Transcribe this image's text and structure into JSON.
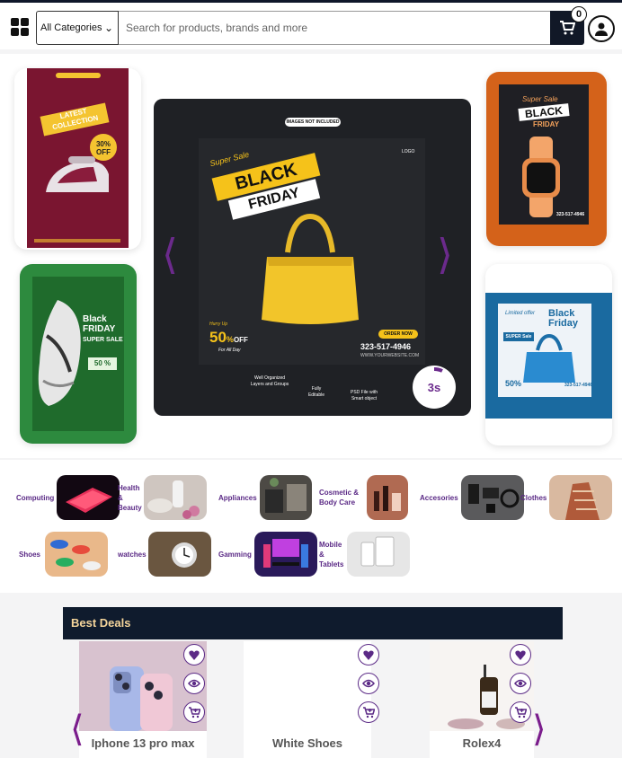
{
  "header": {
    "category_select": "All Categories",
    "search_placeholder": "Search for products, brands and more",
    "cart_count": "0"
  },
  "hero": {
    "timer": "3s",
    "main_banner": {
      "tag": "IMAGES NOT INCLUDED",
      "script": "Super Sale",
      "line1": "BLACK",
      "line2": "FRIDAY",
      "logo": "LOGO",
      "upto": "Hurry Up",
      "discount": "50",
      "discount_unit": "%",
      "off": "OFF",
      "for_all": "For All Day",
      "order": "ORDER NOW",
      "phone": "323-517-4946",
      "website": "WWW.YOURWEBSITE.COM",
      "feature1": "Well Organized Layers and Groups",
      "feature2": "Fully Editable",
      "feature3": "PSD File with Smart object"
    },
    "left_top": {
      "title": "LATEST COLLECTION",
      "badge": "30%",
      "badge_sub": "OFF"
    },
    "left_bottom": {
      "title1": "Black",
      "title2": "FRIDAY",
      "title3": "SUPER SALE",
      "discount": "50 %"
    },
    "right_top": {
      "script": "Super Sale",
      "title1": "BLACK",
      "title2": "FRIDAY",
      "phone": "323-517-4946"
    },
    "right_bottom": {
      "script": "Limited offer",
      "title1": "Black",
      "title2": "Friday",
      "badge": "SUPER Sale",
      "discount": "50%",
      "phone": "323-517-4946"
    }
  },
  "categories": [
    {
      "label": "Computing"
    },
    {
      "label": "Health & Beauty"
    },
    {
      "label": "Appliances"
    },
    {
      "label": "Cosmetic & Body Care"
    },
    {
      "label": "Accesories"
    },
    {
      "label": "Clothes"
    },
    {
      "label": "Shoes"
    },
    {
      "label": "watches"
    },
    {
      "label": "Gamming"
    },
    {
      "label": "Mobile & Tablets"
    }
  ],
  "deals": {
    "title": "Best Deals",
    "products": [
      {
        "name": "Iphone 13 pro max"
      },
      {
        "name": "White Shoes"
      },
      {
        "name": "Rolex4"
      }
    ]
  },
  "colors": {
    "accent": "#5b2a86",
    "navy": "#0f1b2d",
    "gold": "#f5d59b"
  }
}
